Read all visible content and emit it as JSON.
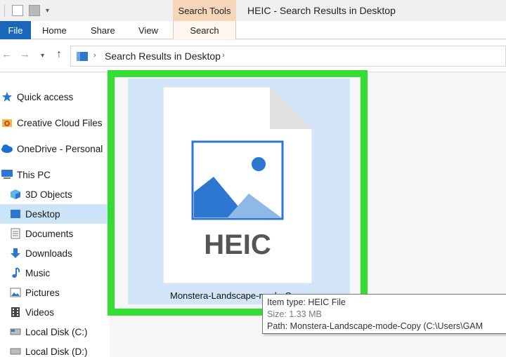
{
  "window": {
    "title": "HEIC - Search Results in Desktop",
    "contextual_tab": "Search Tools"
  },
  "ribbon": {
    "tabs": [
      {
        "label": "File"
      },
      {
        "label": "Home"
      },
      {
        "label": "Share"
      },
      {
        "label": "View"
      },
      {
        "label": "Search"
      }
    ]
  },
  "address": {
    "breadcrumb": "Search Results in Desktop"
  },
  "sidebar": {
    "items": [
      {
        "label": "Quick access",
        "icon": "star-icon"
      },
      {
        "label": "Creative Cloud Files",
        "icon": "creative-cloud-icon"
      },
      {
        "label": "OneDrive - Personal",
        "icon": "onedrive-icon"
      },
      {
        "label": "This PC",
        "icon": "computer-icon"
      },
      {
        "label": "3D Objects",
        "icon": "cube-icon"
      },
      {
        "label": "Desktop",
        "icon": "desktop-icon",
        "selected": true
      },
      {
        "label": "Documents",
        "icon": "documents-icon"
      },
      {
        "label": "Downloads",
        "icon": "download-arrow-icon"
      },
      {
        "label": "Music",
        "icon": "music-note-icon"
      },
      {
        "label": "Pictures",
        "icon": "pictures-icon"
      },
      {
        "label": "Videos",
        "icon": "videos-icon"
      },
      {
        "label": "Local Disk (C:)",
        "icon": "drive-icon"
      },
      {
        "label": "Local Disk (D:)",
        "icon": "drive-icon"
      }
    ]
  },
  "file": {
    "icon_text": "HEIC",
    "name": "Monstera-Landscape-mode-Copy"
  },
  "tooltip": {
    "type": "Item type: HEIC File",
    "size": "Size: 1.33 MB",
    "path": "Path: Monstera-Landscape-mode-Copy (C:\\Users\\GAM"
  },
  "colors": {
    "highlight": "#33dd33",
    "file_tab": "#1a66b8",
    "selection": "#cce4f7",
    "contextual": "#f6d6b8",
    "image_blue": "#2e77d0"
  }
}
